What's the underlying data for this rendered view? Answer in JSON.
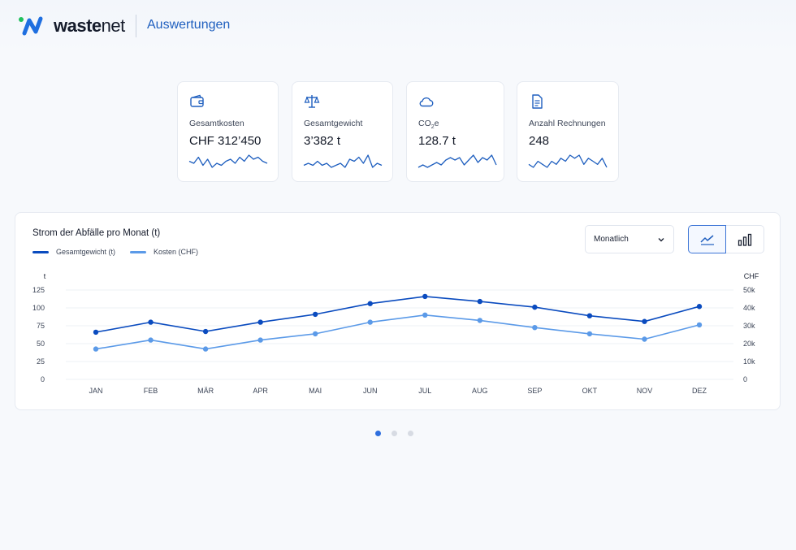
{
  "header": {
    "logo_brand_bold": "waste",
    "logo_brand_light": "net",
    "title": "Auswertungen"
  },
  "kpis": [
    {
      "label": "Gesamtkosten",
      "value": "CHF 312’450",
      "icon": "wallet-icon",
      "sparkline": [
        6,
        5,
        8,
        4,
        7,
        3,
        5,
        4,
        6,
        7,
        5,
        8,
        6,
        9,
        7,
        8,
        6,
        5
      ]
    },
    {
      "label": "Gesamtgewicht",
      "value": "3’382 t",
      "icon": "scale-icon",
      "sparkline": [
        5,
        6,
        5,
        7,
        5,
        6,
        4,
        5,
        6,
        4,
        8,
        7,
        9,
        6,
        10,
        4,
        6,
        5
      ]
    },
    {
      "label_main": "CO",
      "label_sub": "2",
      "label_tail": "e",
      "value": "128.7 t",
      "icon": "cloud-icon",
      "sparkline": [
        4,
        5,
        4,
        5,
        6,
        5,
        7,
        8,
        7,
        8,
        5,
        7,
        9,
        6,
        8,
        7,
        9,
        5
      ]
    },
    {
      "label": "Anzahl Rechnungen",
      "value": "248",
      "icon": "document-icon",
      "sparkline": [
        7,
        6,
        8,
        7,
        6,
        8,
        7,
        9,
        8,
        10,
        9,
        10,
        7,
        9,
        8,
        7,
        9,
        6
      ]
    }
  ],
  "chart_panel": {
    "select_value": "Monatlich"
  },
  "chart_data": {
    "type": "line",
    "title": "Strom der Abfälle pro Monat (t)",
    "categories": [
      "JAN",
      "FEB",
      "MÄR",
      "APR",
      "MAI",
      "JUN",
      "JUL",
      "AUG",
      "SEP",
      "OKT",
      "NOV",
      "DEZ"
    ],
    "series": [
      {
        "name": "Gesamtgewicht (t)",
        "axis": "left",
        "color": "#0a4bbf",
        "values": [
          66,
          80,
          67,
          80,
          91,
          106,
          116,
          109,
          101,
          89,
          81,
          102
        ]
      },
      {
        "name": "Kosten (CHF)",
        "axis": "right",
        "color": "#5b9ae8",
        "values": [
          17000,
          22000,
          17000,
          22000,
          25500,
          32000,
          36000,
          33000,
          29000,
          25500,
          22500,
          30500
        ]
      }
    ],
    "ylabel_left": "t",
    "ylabel_right": "CHF",
    "yticks_left": [
      0,
      25,
      50,
      75,
      100,
      125
    ],
    "yticks_right": [
      "0",
      "10k",
      "20k",
      "30k",
      "40k",
      "50k"
    ],
    "ylim_left": [
      0,
      125
    ],
    "ylim_right": [
      0,
      50000
    ],
    "grid": true
  },
  "pagination": {
    "count": 3,
    "active": 0
  }
}
